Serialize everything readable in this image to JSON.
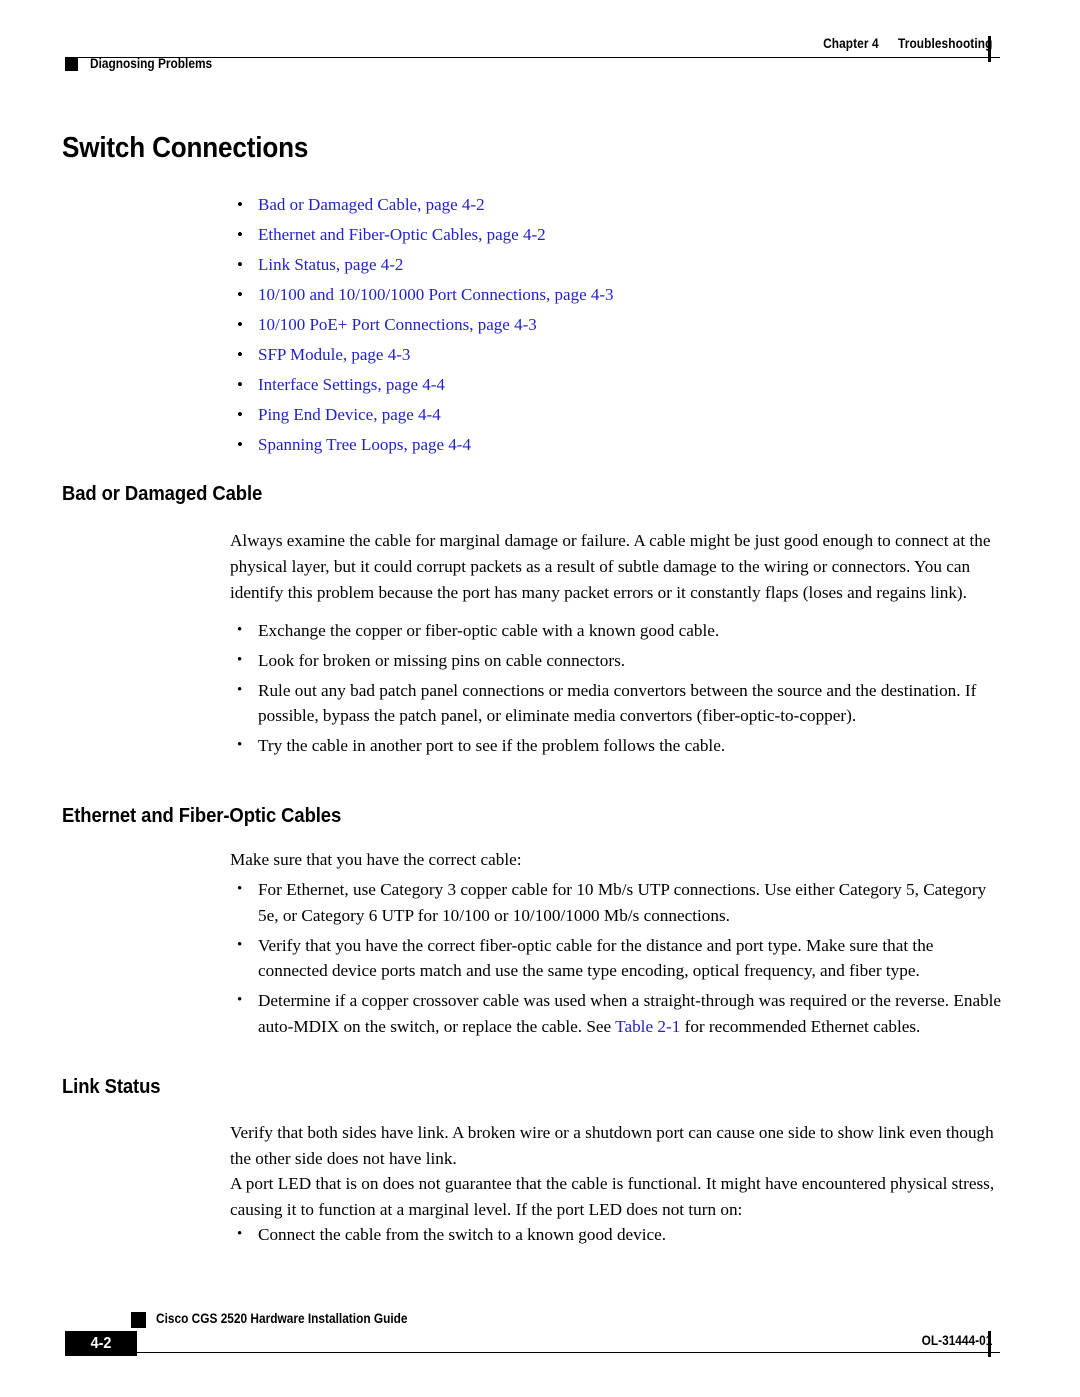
{
  "header": {
    "chapter_label": "Chapter 4",
    "chapter_title": "Troubleshooting",
    "running_head_left": "Diagnosing Problems"
  },
  "page_title": "Switch Connections",
  "link_list": [
    {
      "text": "Bad or Damaged Cable, page 4-2"
    },
    {
      "text": "Ethernet and Fiber-Optic Cables, page 4-2"
    },
    {
      "text": "Link Status, page 4-2"
    },
    {
      "text": "10/100 and 10/100/1000 Port Connections, page 4-3"
    },
    {
      "text": "10/100 PoE+ Port Connections, page 4-3"
    },
    {
      "text": "SFP Module, page 4-3"
    },
    {
      "text": "Interface Settings, page 4-4"
    },
    {
      "text": "Ping End Device, page 4-4"
    },
    {
      "text": "Spanning Tree Loops, page 4-4"
    }
  ],
  "sections": {
    "bad_cable": {
      "heading": "Bad or Damaged Cable",
      "intro": "Always examine the cable for marginal damage or failure. A cable might be just good enough to connect at the physical layer, but it could corrupt packets as a result of subtle damage to the wiring or connectors. You can identify this problem because the port has many packet errors or it constantly flaps (loses and regains link).",
      "bullets": [
        "Exchange the copper or fiber-optic cable with a known good cable.",
        "Look for broken or missing pins on cable connectors.",
        "Rule out any bad patch panel connections or media convertors between the source and the destination. If possible, bypass the patch panel, or eliminate media convertors (fiber-optic-to-copper).",
        "Try the cable in another port to see if the problem follows the cable."
      ]
    },
    "ethernet_fiber": {
      "heading": "Ethernet and Fiber-Optic Cables",
      "intro": "Make sure that you have the correct cable:",
      "bullets": [
        "For Ethernet, use Category 3 copper cable for 10 Mb/s UTP connections. Use either Category 5, Category 5e, or Category 6 UTP for 10/100 or 10/100/1000 Mb/s connections.",
        "Verify that you have the correct fiber-optic cable for the distance and port type. Make sure that the connected device ports match and use the same type encoding, optical frequency, and fiber type."
      ],
      "bullet_with_link": {
        "before": "Determine if a copper crossover cable was used when a straight-through was required or the reverse. Enable auto-MDIX on the switch, or replace the cable. See ",
        "link": "Table 2-1",
        "after": " for recommended Ethernet cables."
      }
    },
    "link_status": {
      "heading": "Link Status",
      "paragraph_1": "Verify that both sides have link. A broken wire or a shutdown port can cause one side to show link even though the other side does not have link.",
      "paragraph_2": "A port LED that is on does not guarantee that the cable is functional. It might have encountered physical stress, causing it to function at a marginal level. If the port LED does not turn on:",
      "bullets": [
        "Connect the cable from the switch to a known good device."
      ]
    }
  },
  "footer": {
    "page_number": "4-2",
    "guide_title": "Cisco CGS 2520 Hardware Installation Guide",
    "doc_id": "OL-31444-01"
  },
  "colors": {
    "link_blue": "#2222cc",
    "text_black": "#000000",
    "page_background": "#ffffff"
  },
  "glyphs": {
    "bullet": "•"
  }
}
